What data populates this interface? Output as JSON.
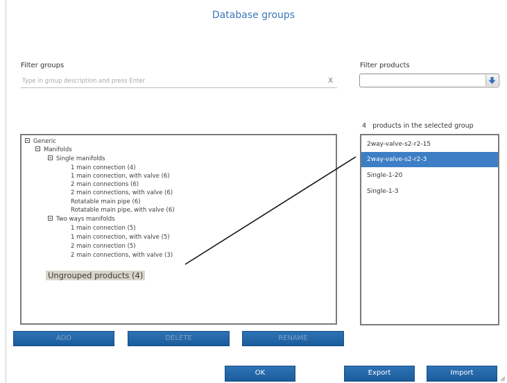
{
  "dialog": {
    "title": "Database groups"
  },
  "filter_groups": {
    "label": "Filter groups",
    "placeholder": "Type in group description and press Enter",
    "clear": "X"
  },
  "filter_products": {
    "label": "Filter products",
    "value": ""
  },
  "products_count": {
    "count": "4",
    "text": "products in the selected group"
  },
  "tree": {
    "generic": "Generic",
    "manifolds": "Manifolds",
    "single_manifolds": "Single manifolds",
    "single_items": [
      "1 main connection (4)",
      "1 main connection, with valve (6)",
      "2 main connections (6)",
      "2 main connections, with valve (6)",
      "Rotatable main pipe (6)",
      "Rotatable main pipe, with valve (6)"
    ],
    "two_ways_manifolds": "Two ways manifolds",
    "two_ways_items": [
      "1 main connection (5)",
      "1 main connection, with valve (5)",
      "2 main connection (5)",
      "2 main connections, with valve (3)"
    ],
    "ungrouped": "Ungrouped products (4)"
  },
  "products": [
    {
      "name": "2way-valve-s2-r2-15",
      "selected": false
    },
    {
      "name": "2way-valve-s2-r2-3",
      "selected": true
    },
    {
      "name": "Single-1-20",
      "selected": false
    },
    {
      "name": "Single-1-3",
      "selected": false
    }
  ],
  "buttons": {
    "add": "ADD",
    "delete": "DELETE",
    "rename": "RENAME",
    "ok": "OK",
    "export": "Export",
    "import": "Import"
  },
  "colors": {
    "accent": "#1b5c9b",
    "selection": "#3d7ec4",
    "title": "#3a78b8",
    "ungrouped_highlight": "#dad5cc"
  },
  "icons": {
    "dropdown": "arrow-down-icon",
    "tree_toggle": "collapse-minus-icon"
  }
}
